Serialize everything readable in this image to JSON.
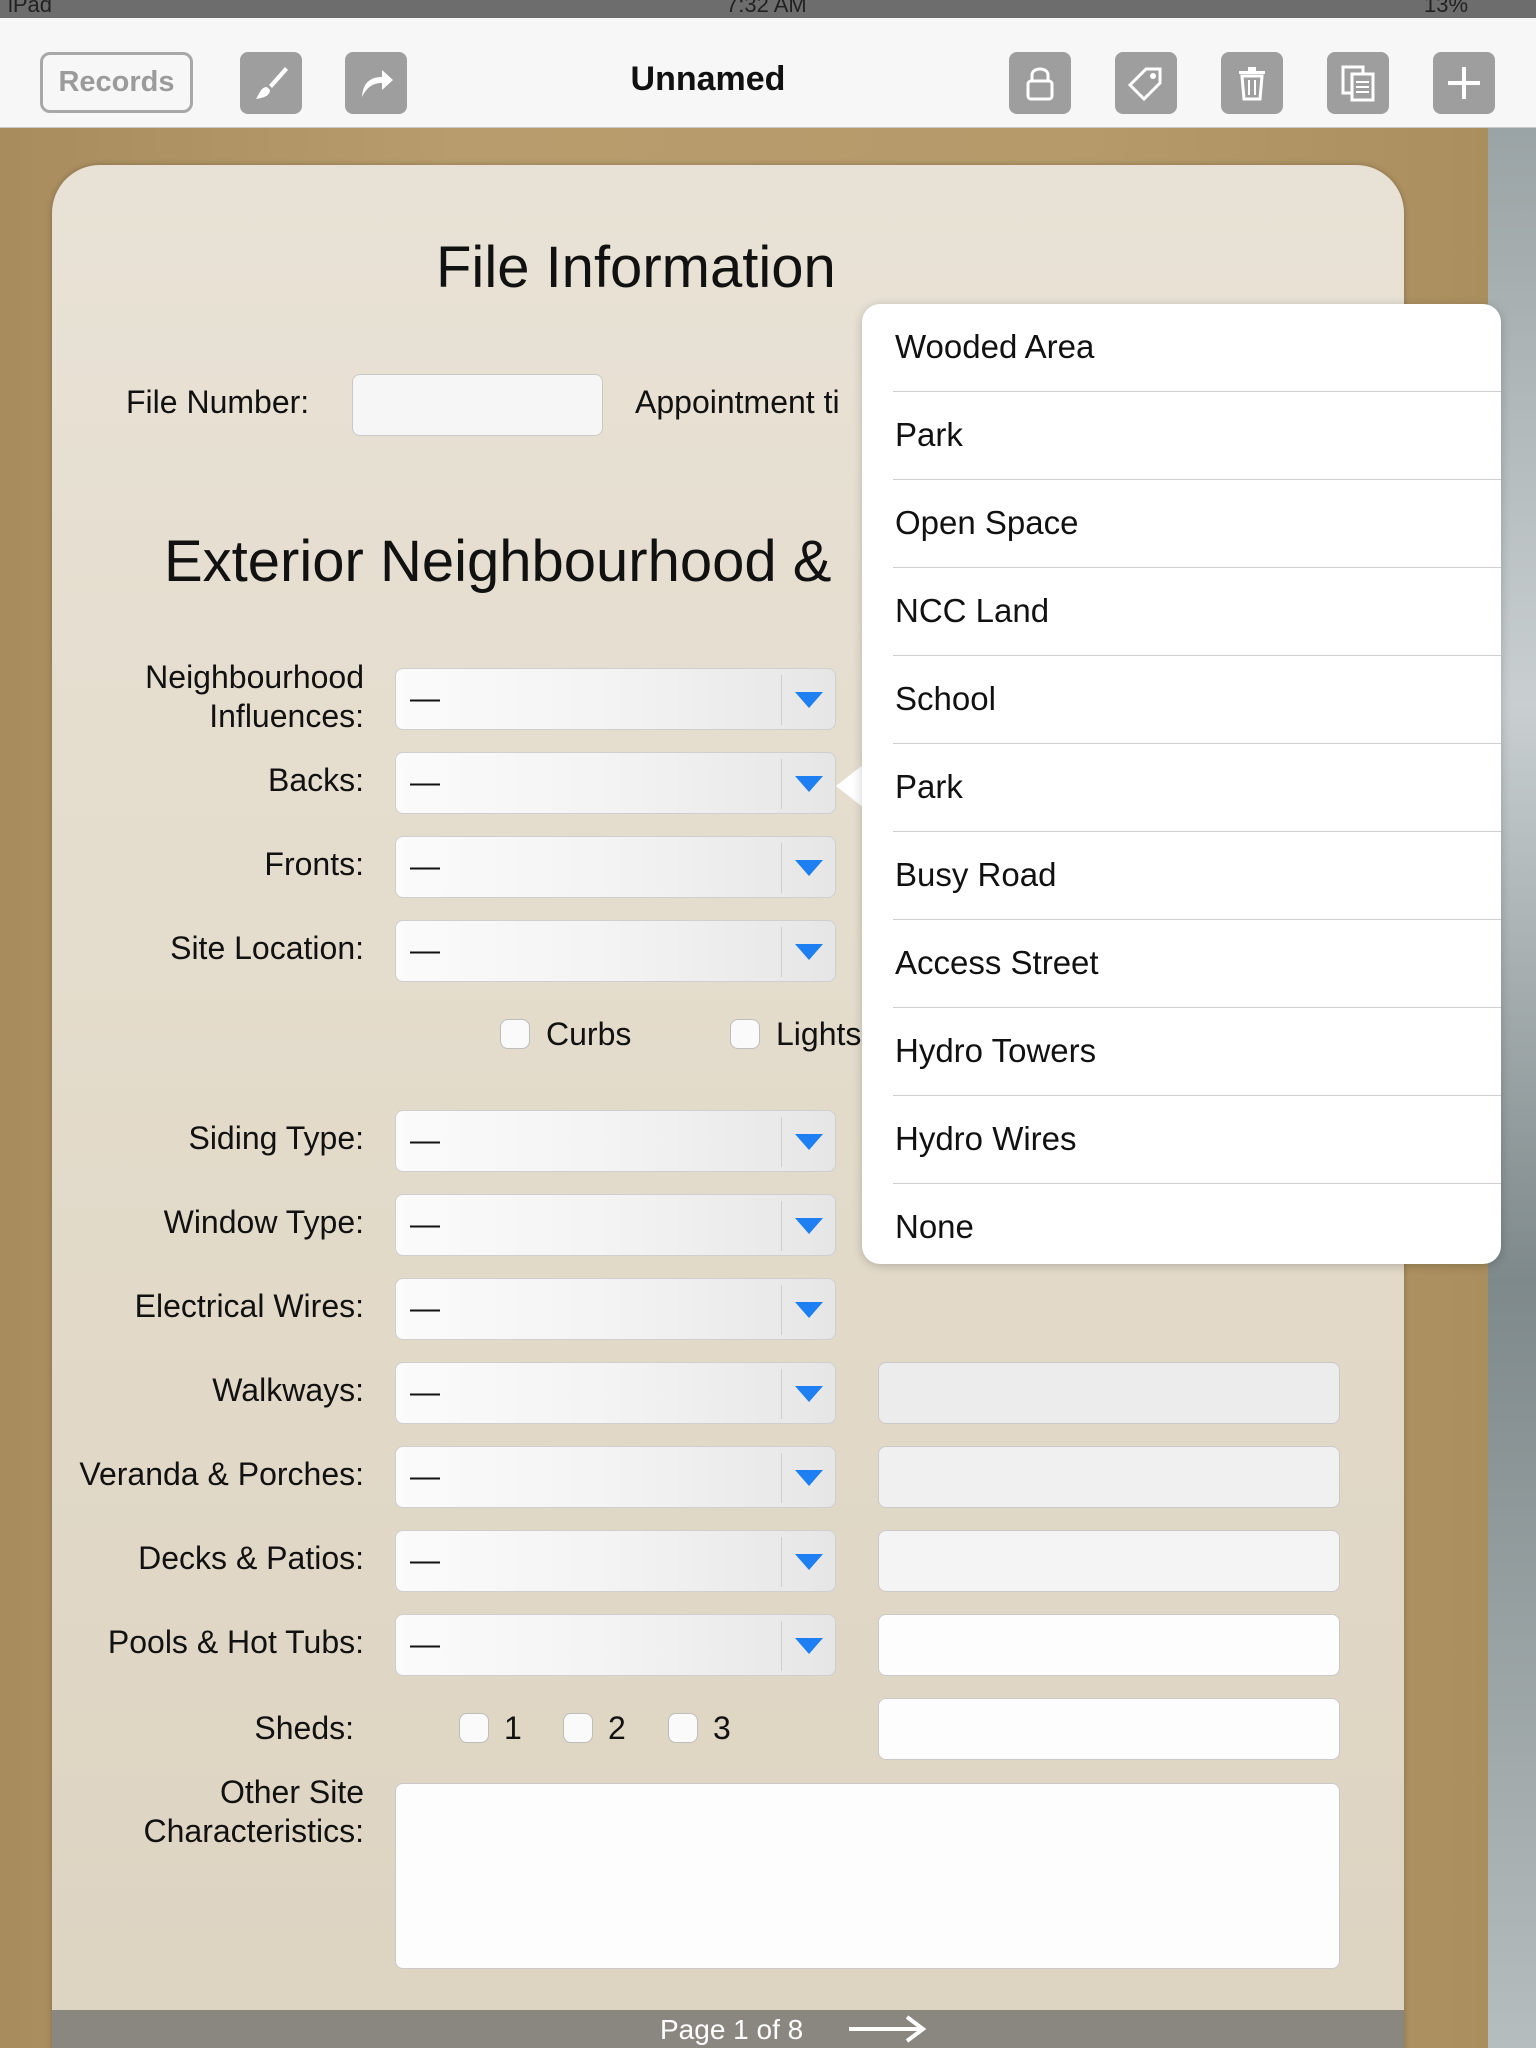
{
  "status": {
    "carrier": "iPad",
    "time": "7:32 AM",
    "battery": "13%"
  },
  "toolbar": {
    "records_label": "Records",
    "title": "Unnamed",
    "icons": [
      "brush-icon",
      "share-icon",
      "lock-icon",
      "tag-icon",
      "trash-icon",
      "duplicate-icon",
      "plus-icon"
    ]
  },
  "form": {
    "heading_file": "File Information",
    "file_number_label": "File Number:",
    "appointment_label": "Appointment ti",
    "heading_exterior": "Exterior Neighbourhood &",
    "fields": [
      {
        "label": "Neighbourhood\nInfluences:",
        "value": "—"
      },
      {
        "label": "Backs:",
        "value": "—"
      },
      {
        "label": "Fronts:",
        "value": "—"
      },
      {
        "label": "Site Location:",
        "value": "—"
      },
      {
        "label": "Siding Type:",
        "value": "—"
      },
      {
        "label": "Window Type:",
        "value": "—"
      },
      {
        "label": "Electrical Wires:",
        "value": "—"
      },
      {
        "label": "Walkways:",
        "value": "—"
      },
      {
        "label": "Veranda & Porches:",
        "value": "—"
      },
      {
        "label": "Decks & Patios:",
        "value": "—"
      },
      {
        "label": "Pools & Hot Tubs:",
        "value": "—"
      }
    ],
    "checks_row": [
      "Curbs",
      "Lights"
    ],
    "sheds_label": "Sheds:",
    "sheds_options": [
      "1",
      "2",
      "3"
    ],
    "other_label_1": "Other Site",
    "other_label_2": "Characteristics:"
  },
  "popover": {
    "items": [
      "Wooded Area",
      "Park",
      "Open Space",
      "NCC Land",
      "School",
      "Park",
      "Busy Road",
      "Access Street",
      "Hydro Towers",
      "Hydro Wires",
      "None"
    ]
  },
  "footer": {
    "page_text": "Page 1 of 8"
  },
  "colors": {
    "accent": "#1e7ff2",
    "toolbar_button": "#9e9e9e"
  }
}
